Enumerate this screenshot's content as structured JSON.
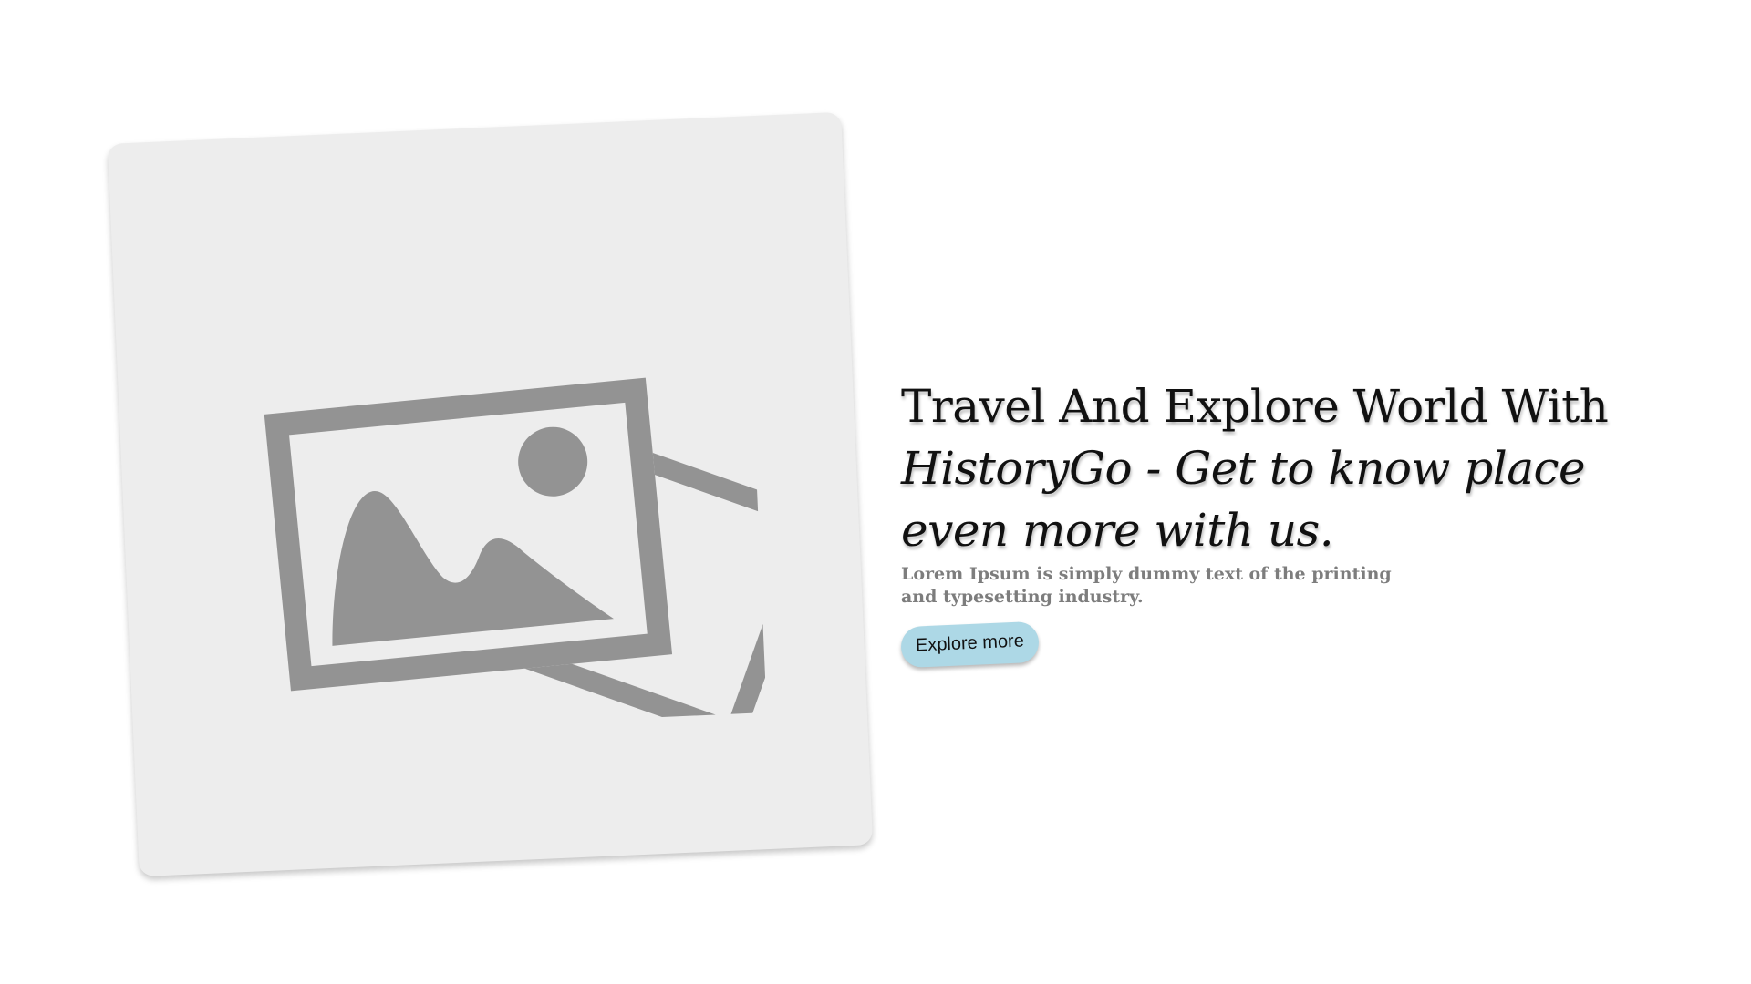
{
  "hero": {
    "title_line": "Travel And Explore World With",
    "title_accent": "HistoryGo - Get to know place even more with us.",
    "subtitle": "Lorem Ipsum is simply dummy text of the printing and typesetting industry.",
    "button_label": "Explore more"
  },
  "image_card": {
    "icon": "image-placeholder-icon",
    "background_color": "#ededed",
    "icon_color": "#939393"
  },
  "colors": {
    "button_background": "#add8e6",
    "subtitle_text": "#7d7d7d",
    "title_text": "#111111"
  }
}
